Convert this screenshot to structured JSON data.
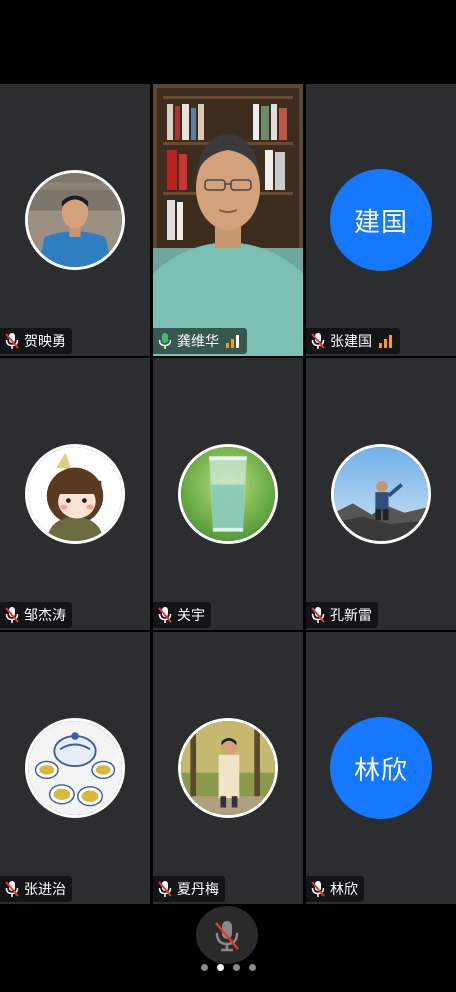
{
  "colors": {
    "tile_bg": "#2b2d2f",
    "avatar_blue": "#1677ff",
    "speaking_border": "#3fbf6a",
    "mic_muted_red": "#e53935",
    "mic_active_green": "#3fbf6a",
    "signal_orange": "#f59b1e"
  },
  "participants": [
    {
      "name": "贺映勇",
      "avatar": "photo-man-blue-shirt",
      "mic": "muted",
      "signal": false
    },
    {
      "name": "龚维华",
      "avatar": "live-video",
      "mic": "active",
      "signal": true
    },
    {
      "name": "张建国",
      "avatar_text": "建国",
      "mic": "muted",
      "signal": true
    },
    {
      "name": "邹杰涛",
      "avatar": "cartoon-kid",
      "mic": "muted",
      "signal": false
    },
    {
      "name": "关宇",
      "avatar": "glass-of-water",
      "mic": "muted",
      "signal": false
    },
    {
      "name": "孔新雷",
      "avatar": "photo-hiker-rocks",
      "mic": "muted",
      "signal": false
    },
    {
      "name": "张进治",
      "avatar": "tea-set",
      "mic": "muted",
      "signal": false
    },
    {
      "name": "夏丹梅",
      "avatar": "photo-woman-trees",
      "mic": "muted",
      "signal": false
    },
    {
      "name": "林欣",
      "avatar_text": "林欣",
      "mic": "muted",
      "signal": false
    }
  ],
  "controls": {
    "main_mic": "mic-muted-icon",
    "pages": 4,
    "active_page": 2
  }
}
